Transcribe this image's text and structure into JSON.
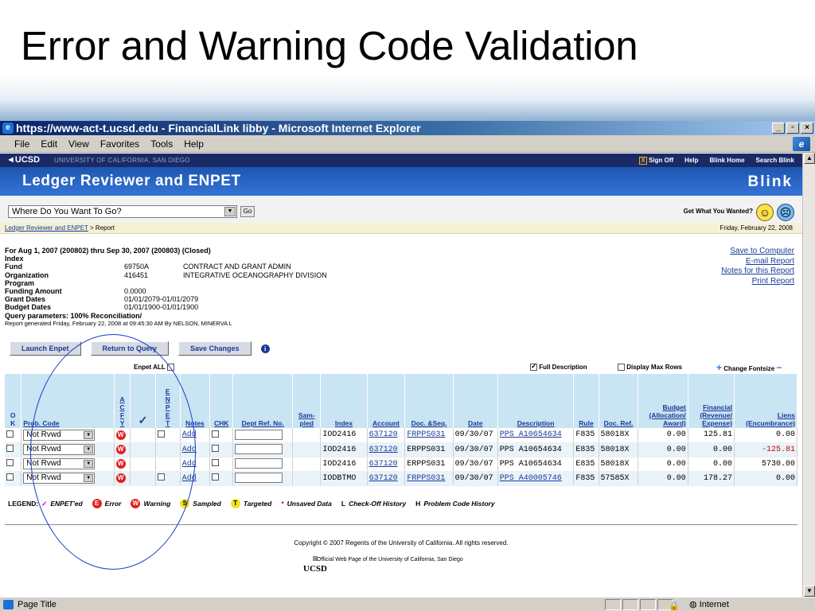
{
  "slide": {
    "title": "Error and Warning Code Validation"
  },
  "browser": {
    "window_title": "https://www-act-t.ucsd.edu - FinancialLink libby - Microsoft Internet Explorer",
    "menu": [
      "File",
      "Edit",
      "View",
      "Favorites",
      "Tools",
      "Help"
    ],
    "status_text": "Page Title",
    "zone": "Internet"
  },
  "ucsd_bar": {
    "logo": "UCSD",
    "subtitle": "UNIVERSITY OF CALIFORNIA, SAN DIEGO",
    "links": [
      "Sign Off",
      "Help",
      "Blink Home",
      "Search Blink"
    ]
  },
  "app": {
    "title": "Ledger Reviewer and ENPET",
    "brand": "Blink"
  },
  "nav": {
    "goto_value": "Where Do You Want To Go?",
    "go_label": "Go",
    "wanted_label": "Get What You Wanted?"
  },
  "breadcrumb": {
    "link": "Ledger Reviewer and ENPET",
    "current": "> Report",
    "date": "Friday, February 22, 2008"
  },
  "report": {
    "heading": "For Aug 1, 2007 (200802) thru Sep 30, 2007 (200803) (Closed)",
    "rows": [
      {
        "label": "Index",
        "value": "",
        "desc": ""
      },
      {
        "label": "Fund",
        "value": "69750A",
        "desc": "CONTRACT AND GRANT ADMIN"
      },
      {
        "label": "Organization",
        "value": "416451",
        "desc": "INTEGRATIVE OCEANOGRAPHY DIVISION"
      },
      {
        "label": "Program",
        "value": "",
        "desc": ""
      },
      {
        "label": "Funding Amount",
        "value": "0.0000",
        "desc": ""
      },
      {
        "label": "Grant Dates",
        "value": "01/01/2079-01/01/2079",
        "desc": ""
      },
      {
        "label": "Budget Dates",
        "value": "01/01/1900-01/01/1900",
        "desc": ""
      }
    ],
    "query": "Query parameters: 100% Reconciliation/",
    "generated": "Report generated Friday, February 22, 2008 at 09:45:30 AM By NELSON, MINERVA L"
  },
  "report_links": [
    "Save to Computer",
    "E-mail Report",
    "Notes for this Report",
    "Print Report"
  ],
  "buttons": {
    "launch": "Launch Enpet",
    "return": "Return to Query",
    "save": "Save Changes"
  },
  "options": {
    "enpet_all": "Enpet ALL",
    "full_desc": "Full Description",
    "max_rows": "Display Max Rows",
    "fontsize": "Change Fontsize"
  },
  "columns": {
    "ok": "O K",
    "prob": "Prob. Code",
    "acfy": "ACFY",
    "check": "✓",
    "enpet": "ENPET",
    "notes": "Notes",
    "chk": "CHK",
    "dept": "Dept Ref. No.",
    "sampled": "Sam-pled",
    "index": "Index",
    "account": "Account",
    "docseq": "Doc. &Seq.",
    "date": "Date",
    "description": "Description",
    "rule": "Rule",
    "docref": "Doc. Ref.",
    "budget": "Budget (Allocation/ Award)",
    "financial": "Financial (Revenue/ Expense)",
    "liens": "Liens (Encumbrance)"
  },
  "rows": [
    {
      "prob": "Not Rvwd",
      "warn": "W",
      "enpet_cb": true,
      "notes": "Add",
      "index": "IOD2416",
      "account": "637120",
      "account_link": true,
      "docseq": "FRPPS031",
      "doc_link": true,
      "date": "09/30/07",
      "description": "PPS A10654634",
      "desc_link": true,
      "rule": "F835",
      "docref": "58018X",
      "budget": "0.00",
      "financial": "125.81",
      "liens": "0.00",
      "neg": false
    },
    {
      "prob": "Not Rvwd",
      "warn": "W",
      "enpet_cb": false,
      "notes": "Add",
      "index": "IOD2416",
      "account": "637120",
      "account_link": true,
      "docseq": "ERPPS031",
      "doc_link": false,
      "date": "09/30/07",
      "description": "PPS A10654634",
      "desc_link": false,
      "rule": "E835",
      "docref": "58018X",
      "budget": "0.00",
      "financial": "0.00",
      "liens": "-125.81",
      "neg": true
    },
    {
      "prob": "Not Rvwd",
      "warn": "W",
      "enpet_cb": false,
      "notes": "Add",
      "index": "IOD2416",
      "account": "637120",
      "account_link": true,
      "docseq": "ERPPS031",
      "doc_link": false,
      "date": "09/30/07",
      "description": "PPS A10654634",
      "desc_link": false,
      "rule": "E835",
      "docref": "58018X",
      "budget": "0.00",
      "financial": "0.00",
      "liens": "5730.00",
      "neg": false
    },
    {
      "prob": "Not Rvwd",
      "warn": "W",
      "enpet_cb": true,
      "notes": "Add",
      "index": "IODBTMO",
      "account": "637120",
      "account_link": true,
      "docseq": "FRPPS031",
      "doc_link": true,
      "date": "09/30/07",
      "description": "PPS A40005746",
      "desc_link": true,
      "rule": "F835",
      "docref": "57585X",
      "budget": "0.00",
      "financial": "178.27",
      "liens": "0.00",
      "neg": false
    }
  ],
  "legend": {
    "label": "LEGEND:",
    "items": [
      {
        "sym": "✓",
        "text": "ENPET'ed"
      },
      {
        "sym": "E",
        "text": "Error"
      },
      {
        "sym": "W",
        "text": "Warning"
      },
      {
        "sym": "S",
        "text": "Sampled"
      },
      {
        "sym": "T",
        "text": "Targeted"
      },
      {
        "sym": "*",
        "text": "Unsaved Data"
      },
      {
        "sym": "L",
        "text": "Check-Off History"
      },
      {
        "sym": "H",
        "text": "Problem Code History"
      }
    ]
  },
  "footer": {
    "copyright": "Copyright © 2007 Regents of the University of California. All rights reserved.",
    "official": "Official Web Page of the University of California, San Diego",
    "logo": "UCSD"
  },
  "colors": {
    "ucsd_navy": "#1a2a66",
    "header_blue": "#2a66c4",
    "table_header": "#c9e4f2",
    "warning_red": "#e22020",
    "link": "#1a3a99"
  }
}
